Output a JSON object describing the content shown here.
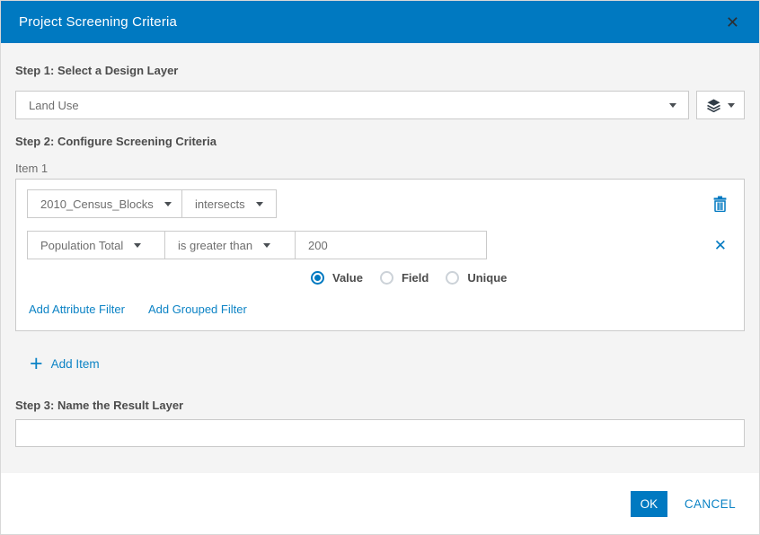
{
  "dialog": {
    "title": "Project Screening Criteria"
  },
  "icons": {
    "close": "✕",
    "remove": "✕",
    "plus": "+"
  },
  "colors": {
    "header_bg": "#0079c1",
    "accent": "#0079c1",
    "link": "#0c83c5",
    "border": "#cacaca",
    "content_bg": "#f4f4f4"
  },
  "step1": {
    "label": "Step 1: Select a Design Layer",
    "design_layer": {
      "value": "Land Use"
    }
  },
  "step2": {
    "label": "Step 2: Configure Screening Criteria",
    "item_label": "Item 1",
    "item": {
      "layer": "2010_Census_Blocks",
      "spatial_operator": "intersects",
      "filter": {
        "field": "Population Total",
        "operator": "is greater than",
        "value": "200"
      },
      "value_type": {
        "options": [
          "Value",
          "Field",
          "Unique"
        ],
        "selected": "Value"
      },
      "add_attribute_filter": "Add Attribute Filter",
      "add_grouped_filter": "Add Grouped Filter"
    },
    "add_item": "Add Item"
  },
  "step3": {
    "label": "Step 3: Name the Result Layer",
    "value": ""
  },
  "footer": {
    "ok": "OK",
    "cancel": "CANCEL"
  }
}
